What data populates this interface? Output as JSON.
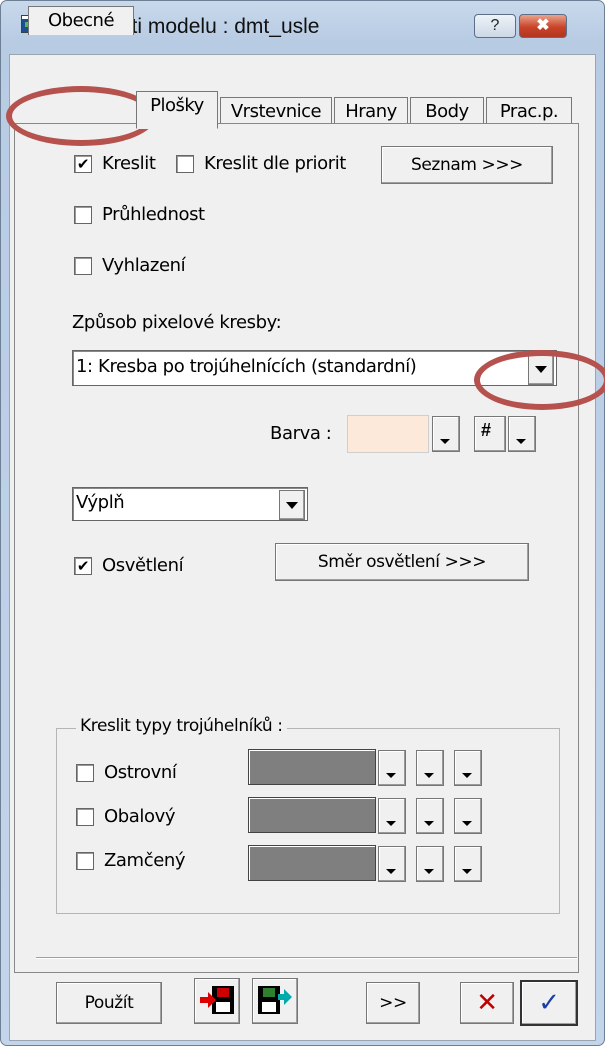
{
  "window": {
    "title": "Vlastnosti modelu : dmt_usle",
    "help_label": "?",
    "close_label": "✖"
  },
  "tabs": [
    {
      "label": "Obecné"
    },
    {
      "label": "Plošky"
    },
    {
      "label": "Vrstevnice"
    },
    {
      "label": "Hrany"
    },
    {
      "label": "Body"
    },
    {
      "label": "Prac.p."
    }
  ],
  "active_tab": "Plošky",
  "options": {
    "kreslit": {
      "label": "Kreslit",
      "checked": true
    },
    "kreslit_dle_priorit": {
      "label": "Kreslit dle priorit",
      "checked": false
    },
    "seznam_button": "Seznam >>>",
    "pruhlednost": {
      "label": "Průhlednost",
      "checked": false
    },
    "vyhlazeni": {
      "label": "Vyhlazení",
      "checked": false
    }
  },
  "pixel_mode": {
    "label": "Způsob pixelové kresby:",
    "value": "1: Kresba po trojúhelnících (standardní)"
  },
  "color": {
    "label": "Barva :",
    "swatch_color": "#fde9d9"
  },
  "fill": {
    "value": "Výplň"
  },
  "lighting": {
    "label": "Osvětlení",
    "checked": true,
    "direction_button": "Směr osvětlení >>>"
  },
  "triangle_types": {
    "title": "Kreslit typy trojúhelníků :",
    "items": [
      {
        "label": "Ostrovní",
        "checked": false
      },
      {
        "label": "Obalový",
        "checked": false
      },
      {
        "label": "Zamčený",
        "checked": false
      }
    ],
    "swatch_color": "#7f7f7f"
  },
  "footer": {
    "apply_label": "Použít",
    "more_label": ">>",
    "cancel_label": "✕",
    "ok_label": "✓"
  },
  "annotation_color": "#b5524e"
}
